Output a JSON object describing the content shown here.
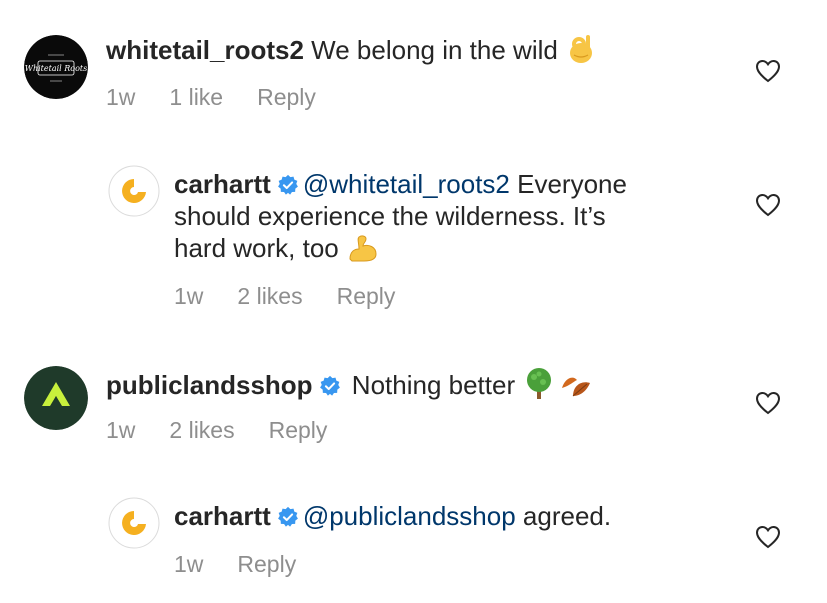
{
  "comments": [
    {
      "username": "whitetail_roots2",
      "verified": false,
      "text": " We belong in the wild",
      "emoji": "ok-hand",
      "time": "1w",
      "likes": "1 like",
      "reply": "Reply",
      "avatar_text_top": "WHITETAIL",
      "avatar_text_main": "Whitetail Roots"
    },
    {
      "username": "carhartt",
      "verified": true,
      "mention": "@whitetail_roots2",
      "text_line1": " Everyone",
      "text_line2": "should experience the wilderness. It’s",
      "text_line3": "hard work, too",
      "emoji": "flexed-biceps",
      "time": "1w",
      "likes": "2 likes",
      "reply": "Reply"
    },
    {
      "username": "publiclandsshop",
      "verified": true,
      "text": " Nothing better",
      "emoji": [
        "deciduous-tree",
        "fallen-leaf"
      ],
      "time": "1w",
      "likes": "2 likes",
      "reply": "Reply"
    },
    {
      "username": "carhartt",
      "verified": true,
      "mention": "@publiclandsshop",
      "text": " agreed.",
      "time": "1w",
      "reply": "Reply"
    }
  ],
  "colors": {
    "text": "#262626",
    "secondary": "#8e8e8e",
    "mention": "#00376b",
    "verified": "#3897f0",
    "carhartt_yellow": "#f5b020",
    "publiclands_green": "#1f3a2a",
    "publiclands_accent": "#c8f03c"
  }
}
